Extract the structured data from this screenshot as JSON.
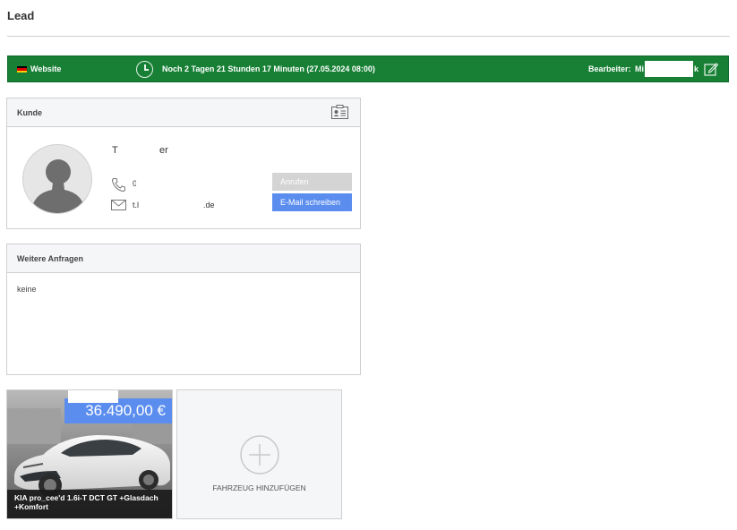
{
  "page": {
    "title": "Lead"
  },
  "status_bar": {
    "source": "Website",
    "countdown": "Noch 2 Tagen 21 Stunden 17 Minuten  (27.05.2024 08:00)",
    "editor_label": "Bearbeiter:",
    "editor_name_start": "Mi",
    "editor_name_end": "k",
    "background_color": "#178035"
  },
  "customer": {
    "header": "Kunde",
    "name_start": "T",
    "name_end": "er",
    "phone_partial": "0",
    "email_start": "t.l",
    "email_end": ".de",
    "call_button": "Anrufen",
    "email_button": "E-Mail schreiben",
    "email_button_color": "#5b8def"
  },
  "requests": {
    "header": "Weitere Anfragen",
    "body": "keine"
  },
  "vehicle": {
    "price": "36.490,00 €",
    "title": "KIA pro_cee'd 1.6i-T DCT GT +Glasdach +Komfort"
  },
  "add_vehicle": {
    "label": "FAHRZEUG HINZUFÜGEN"
  }
}
